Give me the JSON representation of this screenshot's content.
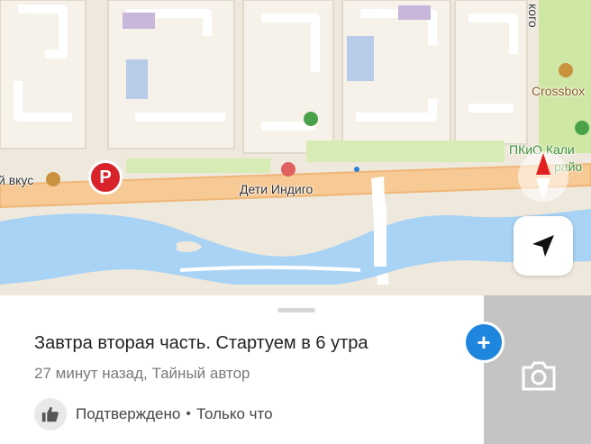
{
  "map": {
    "labels": {
      "dety_indigo": "Дети Индиго",
      "vkus": "й вкус",
      "crossbox": "Crossbox",
      "pkio": "ПКиО Кали",
      "rayo": "райо",
      "street_top": "кого"
    },
    "icons": {
      "parking": "P",
      "compass": "compass-icon",
      "locate": "navigation-arrow-icon"
    },
    "colors": {
      "water": "#a9d3f4",
      "road": "#f6c995",
      "park": "#cfe7a5",
      "building": "#e7e2d6",
      "block": "#f3efe5"
    }
  },
  "sheet": {
    "title": "Завтра вторая часть. Стартуем в 6 утра",
    "meta": "27 минут назад, Тайный автор",
    "confirm_status": "Подтверждено",
    "confirm_separator": "•",
    "confirm_time": "Только что",
    "add_label": "+",
    "camera_icon": "camera-icon",
    "accent": "#1f86de"
  }
}
